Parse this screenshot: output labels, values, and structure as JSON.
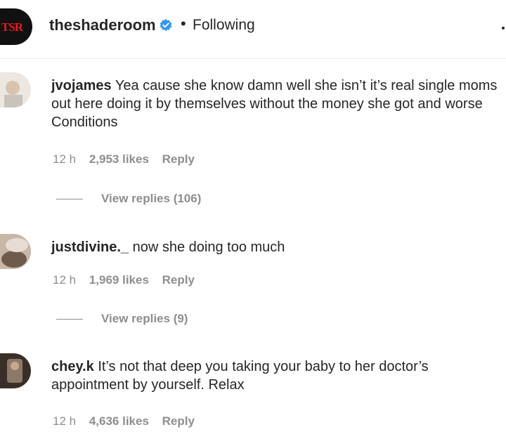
{
  "header": {
    "account": "theshaderoom",
    "separator": "•",
    "follow_status": "Following"
  },
  "comments": [
    {
      "username": "jvojames",
      "text": "Yea cause she know damn well she isn’t it’s real single moms out here doing it by themselves without the money she got and worse Conditions",
      "time": "12 h",
      "likes": "2,953 likes",
      "reply": "Reply",
      "view_replies": "View replies (106)"
    },
    {
      "username": "justdivine._",
      "text": "now she doing too much",
      "time": "12 h",
      "likes": "1,969 likes",
      "reply": "Reply",
      "view_replies": "View replies (9)"
    },
    {
      "username": "chey.k",
      "text": "It’s not that deep you taking your baby to her doctor’s appointment by yourself. Relax",
      "time": "12 h",
      "likes": "4,636 likes",
      "reply": "Reply"
    }
  ],
  "colors": {
    "text": "#262626",
    "secondary": "#8e8e8e",
    "verified": "#3897f0",
    "brand_red": "#e21b23"
  }
}
